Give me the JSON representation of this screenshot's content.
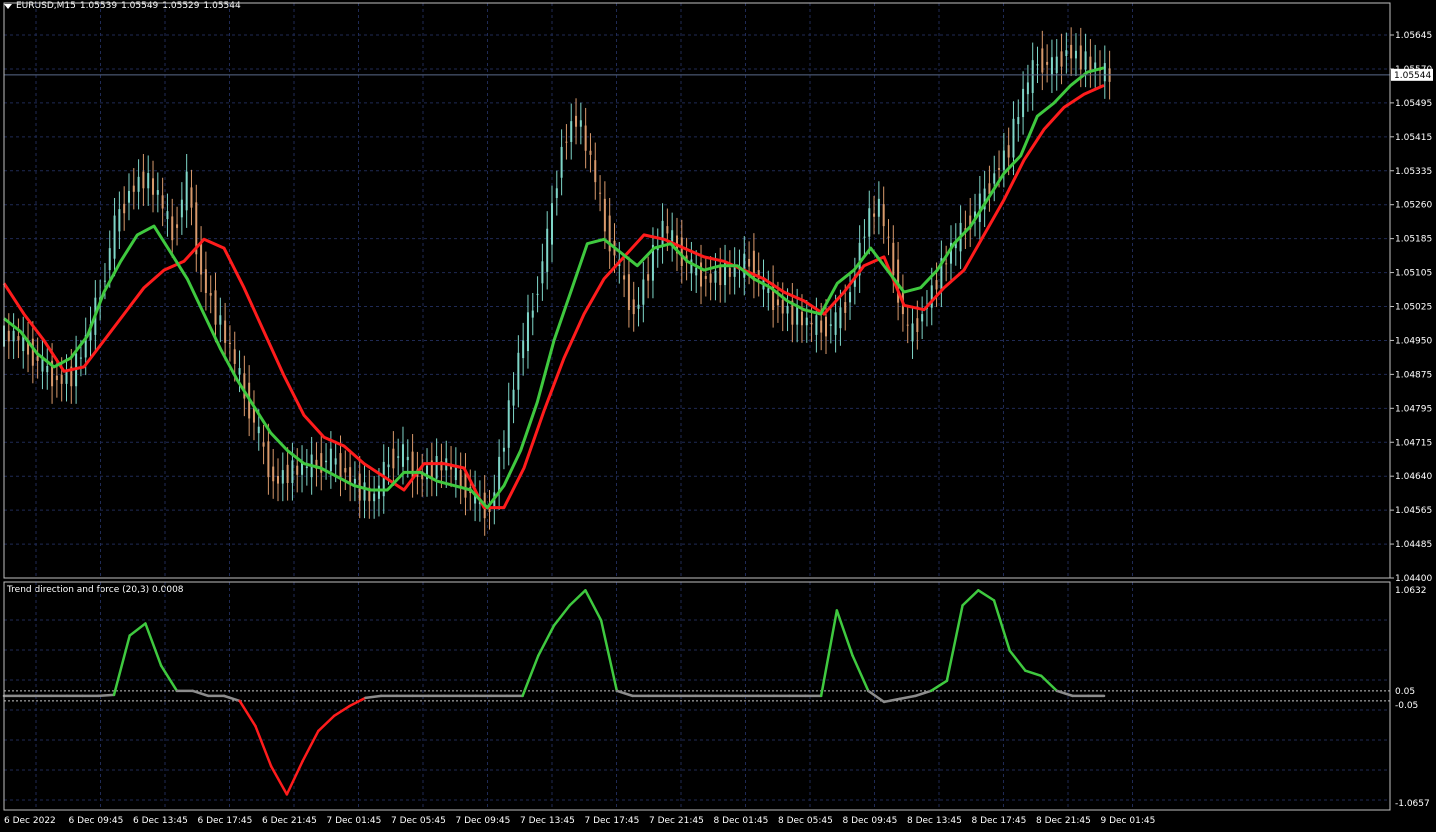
{
  "header": {
    "symbol": "EURUSD,M15",
    "open": "1.05539",
    "high": "1.05549",
    "low": "1.05529",
    "close": "1.05544"
  },
  "indicator": {
    "label": "Trend direction and force (20,3) 0.0008"
  },
  "colors": {
    "background": "#000000",
    "grid": "#1f2a55",
    "frame": "#c0c0c0",
    "candle_up": "#7fd6c8",
    "candle_down": "#d99a6c",
    "fast_ma": "#3fc93f",
    "slow_ma": "#ff1c1c",
    "ind_up": "#3fc93f",
    "ind_down": "#ff1c1c",
    "ind_neutral": "#8c8c8c"
  },
  "chart_data": [
    {
      "type": "line",
      "title": "EURUSD,M15",
      "price_axis_ticks": [
        "1.05645",
        "1.05570",
        "1.05495",
        "1.05415",
        "1.05335",
        "1.05260",
        "1.05185",
        "1.05105",
        "1.05025",
        "1.04950",
        "1.04875",
        "1.04795",
        "1.04715",
        "1.04640",
        "1.04565",
        "1.04485",
        "1.04400"
      ],
      "current_price_label": "1.05544",
      "ylim": [
        1.044,
        1.0568
      ],
      "time_axis_ticks": [
        "6 Dec 2022",
        "6 Dec 09:45",
        "6 Dec 13:45",
        "6 Dec 17:45",
        "6 Dec 21:45",
        "7 Dec 01:45",
        "7 Dec 05:45",
        "7 Dec 09:45",
        "7 Dec 13:45",
        "7 Dec 17:45",
        "7 Dec 21:45",
        "8 Dec 01:45",
        "8 Dec 05:45",
        "8 Dec 09:45",
        "8 Dec 13:45",
        "8 Dec 17:45",
        "8 Dec 21:45",
        "9 Dec 01:45"
      ],
      "series": [
        {
          "name": "close",
          "values": [
            1.0495,
            1.0492,
            1.0488,
            1.0485,
            1.0486,
            1.0494,
            1.0505,
            1.052,
            1.0528,
            1.0531,
            1.0527,
            1.0518,
            1.053,
            1.0509,
            1.05,
            1.0492,
            1.0482,
            1.0472,
            1.0462,
            1.0464,
            1.0465,
            1.0466,
            1.0467,
            1.0464,
            1.046,
            1.0458,
            1.0467,
            1.0468,
            1.0463,
            1.0465,
            1.0466,
            1.0462,
            1.0458,
            1.0455,
            1.0472,
            1.049,
            1.0502,
            1.0517,
            1.0538,
            1.0545,
            1.0535,
            1.052,
            1.051,
            1.05,
            1.051,
            1.052,
            1.0515,
            1.051,
            1.0508,
            1.0509,
            1.051,
            1.0512,
            1.0506,
            1.0502,
            1.05,
            1.0498,
            1.0497,
            1.0498,
            1.0505,
            1.052,
            1.0525,
            1.051,
            1.0495,
            1.05,
            1.0508,
            1.0515,
            1.052,
            1.0525,
            1.0532,
            1.0538,
            1.055,
            1.0558,
            1.0556,
            1.056,
            1.0558,
            1.0556,
            1.0554
          ]
        },
        {
          "name": "fast",
          "values": [
            1.0499,
            1.0496,
            1.0491,
            1.0488,
            1.049,
            1.0495,
            1.0505,
            1.0512,
            1.0518,
            1.052,
            1.0514,
            1.0508,
            1.05,
            1.0492,
            1.0485,
            1.0479,
            1.0473,
            1.0469,
            1.0466,
            1.0465,
            1.0463,
            1.0461,
            1.046,
            1.046,
            1.0464,
            1.0464,
            1.0462,
            1.0461,
            1.046,
            1.0456,
            1.0461,
            1.0469,
            1.048,
            1.0494,
            1.0505,
            1.0516,
            1.0517,
            1.0514,
            1.0511,
            1.0515,
            1.0516,
            1.0512,
            1.051,
            1.0511,
            1.0511,
            1.0508,
            1.0506,
            1.0503,
            1.0501,
            1.05,
            1.0507,
            1.051,
            1.0515,
            1.051,
            1.0505,
            1.0506,
            1.051,
            1.0516,
            1.052,
            1.0526,
            1.0532,
            1.0536,
            1.0545,
            1.0548,
            1.0552,
            1.0555,
            1.0556
          ]
        },
        {
          "name": "slow",
          "values": [
            1.0507,
            1.05,
            1.0494,
            1.0487,
            1.0488,
            1.0494,
            1.05,
            1.0506,
            1.051,
            1.0512,
            1.0517,
            1.0515,
            1.0506,
            1.0496,
            1.0486,
            1.0477,
            1.0472,
            1.047,
            1.0466,
            1.0463,
            1.046,
            1.0466,
            1.0466,
            1.0465,
            1.0456,
            1.0456,
            1.0465,
            1.0478,
            1.049,
            1.05,
            1.0508,
            1.0513,
            1.0518,
            1.0517,
            1.0515,
            1.0513,
            1.0512,
            1.051,
            1.0508,
            1.0505,
            1.0503,
            1.05,
            1.0505,
            1.0511,
            1.0513,
            1.0502,
            1.0501,
            1.0506,
            1.051,
            1.0518,
            1.0526,
            1.0535,
            1.0542,
            1.0547,
            1.055,
            1.0552
          ]
        }
      ]
    },
    {
      "type": "line",
      "title": "Trend direction and force (20,3) 0.0008",
      "axis_ticks": [
        "1.0632",
        "0.05",
        "-0.05",
        "-1.0657"
      ],
      "ylim": [
        -1.0657,
        1.0632
      ],
      "levels": [
        0.05,
        -0.05
      ],
      "series": [
        {
          "name": "Trend direction and force",
          "values": [
            0.0,
            0.0,
            0.0,
            0.0,
            0.0,
            0.0,
            0.0,
            0.01,
            0.6,
            0.72,
            0.3,
            0.05,
            0.05,
            0.0,
            0.0,
            -0.05,
            -0.3,
            -0.7,
            -0.98,
            -0.65,
            -0.35,
            -0.2,
            -0.1,
            -0.02,
            0.0,
            0.0,
            0.0,
            0.0,
            0.0,
            0.0,
            0.0,
            0.0,
            0.0,
            0.0,
            0.4,
            0.7,
            0.9,
            1.05,
            0.75,
            0.05,
            0.0,
            0.0,
            0.0,
            0.0,
            0.0,
            0.0,
            0.0,
            0.0,
            0.0,
            0.0,
            0.0,
            0.0,
            0.0,
            0.85,
            0.4,
            0.05,
            -0.06,
            -0.03,
            0.0,
            0.05,
            0.15,
            0.9,
            1.05,
            0.95,
            0.45,
            0.25,
            0.2,
            0.05,
            0.0,
            0.0,
            0.0
          ]
        }
      ]
    }
  ]
}
